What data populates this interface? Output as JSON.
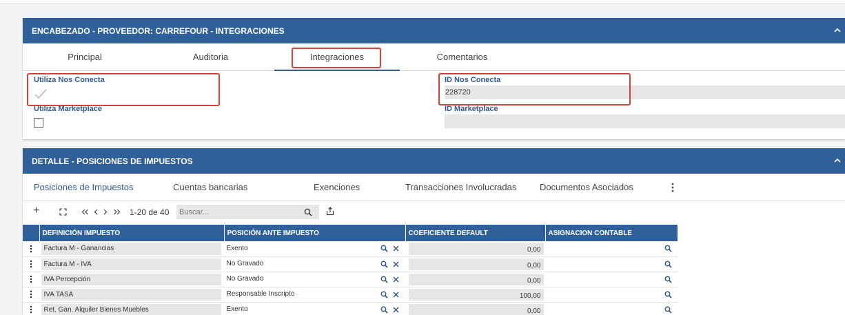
{
  "header_panel": {
    "title": "ENCABEZADO - PROVEEDOR: CARREFOUR - INTEGRACIONES",
    "tabs": [
      {
        "label": "Principal"
      },
      {
        "label": "Auditoria"
      },
      {
        "label": "Integraciones"
      },
      {
        "label": "Comentarios"
      }
    ],
    "active_tab": "Integraciones",
    "fields": {
      "utiliza_nos_conecta": {
        "label": "Utiliza Nos Conecta",
        "checked": true
      },
      "id_nos_conecta": {
        "label": "ID Nos Conecta",
        "value": "228720"
      },
      "utiliza_marketplace": {
        "label": "Utiliza Marketplace",
        "checked": false
      },
      "id_marketplace": {
        "label": "ID Marketplace",
        "value": ""
      }
    }
  },
  "detail_panel": {
    "title": "DETALLE - POSICIONES DE IMPUESTOS",
    "tabs": [
      {
        "label": "Posiciones de Impuestos"
      },
      {
        "label": "Cuentas bancarias"
      },
      {
        "label": "Exenciones"
      },
      {
        "label": "Transacciones Involucradas"
      },
      {
        "label": "Documentos Asociados"
      }
    ],
    "active_tab": "Posiciones de Impuestos",
    "toolbar": {
      "add": "+",
      "pager": "1-20 de 40",
      "search_placeholder": "Buscar..."
    },
    "table": {
      "columns": [
        "DEFINICIÓN IMPUESTO",
        "POSICIÓN ANTE IMPUESTO",
        "COEFICIENTE DEFAULT",
        "ASIGNACION CONTABLE"
      ],
      "rows": [
        [
          "Factura M - Ganancias",
          "Exento",
          "0,00",
          ""
        ],
        [
          "Factura M - IVA",
          "No Gravado",
          "0,00",
          ""
        ],
        [
          "IVA Percepción",
          "No Gravado",
          "0,00",
          ""
        ],
        [
          "IVA TASA",
          "Responsable Inscripto",
          "100,00",
          ""
        ],
        [
          "Ret. Gan. Alquiler Bienes Muebles",
          "Exento",
          "0,00",
          ""
        ]
      ]
    }
  },
  "colors": {
    "header_blue": "#30609a",
    "label_blue": "#2f5a8e",
    "highlight_red": "#d9403a",
    "field_gray": "#e6e6e6"
  }
}
